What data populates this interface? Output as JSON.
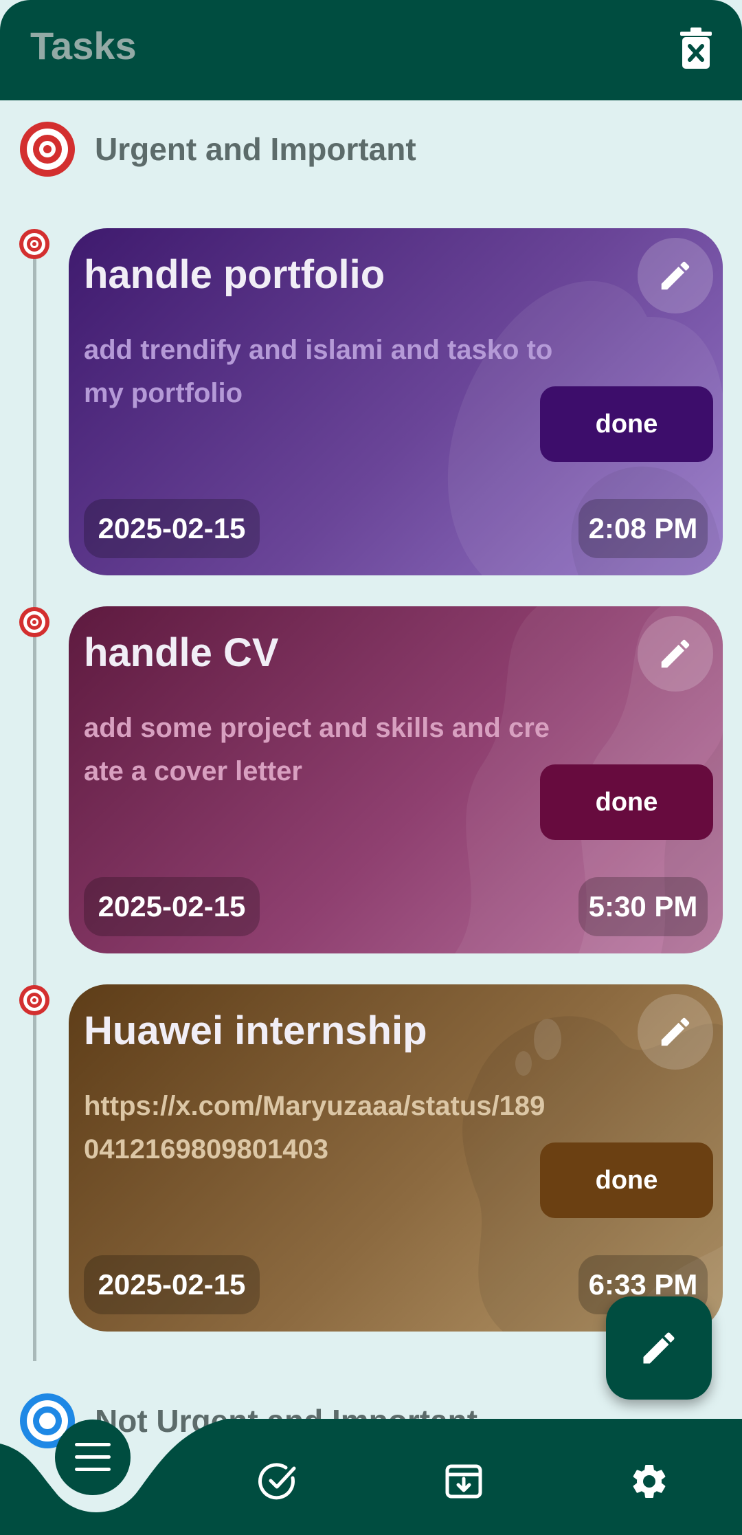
{
  "appbar": {
    "title": "Tasks",
    "clear_icon": "delete-sweep-icon"
  },
  "colors": {
    "primary": "#004d40",
    "background": "#e0f1f1",
    "urgent_red": "#d32f2f",
    "not_urgent_blue": "#1e88e5"
  },
  "sections": [
    {
      "label": "Urgent and Important",
      "icon": "target-icon"
    },
    {
      "label": "Not Urgent and Important",
      "icon": "target-icon"
    }
  ],
  "tasks": [
    {
      "title": "handle portfolio",
      "description": "add trendify and islami and tasko to my portfolio",
      "done_label": "done",
      "date": "2025-02-15",
      "time": "2:08 PM",
      "theme": "purple"
    },
    {
      "title": "handle CV",
      "description": "add some project and skills and create a cover letter",
      "done_label": "done",
      "date": "2025-02-15",
      "time": "5:30 PM",
      "theme": "maroon"
    },
    {
      "title": "Huawei internship",
      "description": "https://x.com/Maryuzaaa/status/1890412169809801403",
      "done_label": "done",
      "date": "2025-02-15",
      "time": "6:33 PM",
      "theme": "brown"
    }
  ],
  "fab": {
    "icon": "edit-icon"
  },
  "bottom_nav": [
    {
      "icon": "menu-icon",
      "active": true
    },
    {
      "icon": "check-circle-icon",
      "active": false
    },
    {
      "icon": "archive-icon",
      "active": false
    },
    {
      "icon": "settings-icon",
      "active": false
    }
  ]
}
